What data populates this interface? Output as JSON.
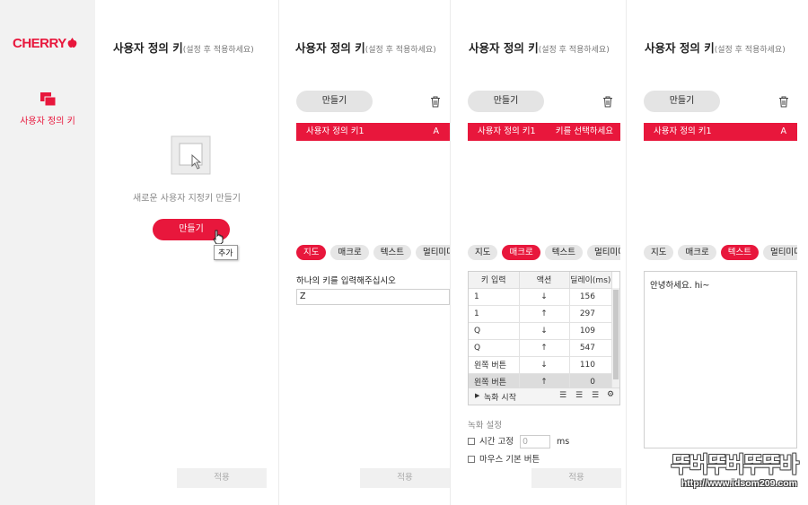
{
  "app": {
    "logo_text": "CHERRY",
    "nav_label": "사용자 정의 키"
  },
  "colors": {
    "accent": "#e8173c",
    "sidebar_bg": "#f2f2f2"
  },
  "panel_title": {
    "main": "사용자 정의 키",
    "sub": "(설정 후 적용하세요)"
  },
  "empty_panel": {
    "message": "새로운 사용자 지정키 만들기",
    "create_label": "만들기",
    "tooltip": "추가",
    "apply_label": "적용"
  },
  "panel2": {
    "create_label": "만들기",
    "key_name": "사용자 정의 키1",
    "key_value": "A",
    "tabs": [
      "지도",
      "매크로",
      "텍스트",
      "멀티미디어"
    ],
    "active_tab": 0,
    "input_label": "하나의 키를 입력해주십시오",
    "input_value": "Z",
    "apply_label": "적용"
  },
  "panel3": {
    "create_label": "만들기",
    "key_name": "사용자 정의 키1",
    "key_value": "키를 선택하세요",
    "tabs": [
      "지도",
      "매크로",
      "텍스트",
      "멀티미디어"
    ],
    "active_tab": 1,
    "table_headers": [
      "키 입력",
      "액션",
      "딜레이(ms)"
    ],
    "rows": [
      {
        "key": "1",
        "action": "↓",
        "delay": "156"
      },
      {
        "key": "1",
        "action": "↑",
        "delay": "297"
      },
      {
        "key": "Q",
        "action": "↓",
        "delay": "109"
      },
      {
        "key": "Q",
        "action": "↑",
        "delay": "547"
      },
      {
        "key": "왼쪽 버튼",
        "action": "↓",
        "delay": "110"
      },
      {
        "key": "왼쪽 버튼",
        "action": "↑",
        "delay": "0"
      }
    ],
    "selected_row": 5,
    "record_label": "녹화 시작",
    "settings_title": "녹화 설정",
    "fixed_time_label": "시간 고정",
    "fixed_time_value": "0",
    "ms_label": "ms",
    "mouse_label": "마우스 기본 버튼",
    "apply_label": "적용"
  },
  "panel4": {
    "create_label": "만들기",
    "key_name": "사용자 정의 키1",
    "key_value": "A",
    "tabs": [
      "지도",
      "매크로",
      "텍스트",
      "멀티미디어"
    ],
    "active_tab": 2,
    "text_value": "안녕하세요. hi~"
  },
  "watermark": {
    "big": "뚜버뚜버뚜뚜바",
    "small": "http://www.idsom209.com"
  }
}
